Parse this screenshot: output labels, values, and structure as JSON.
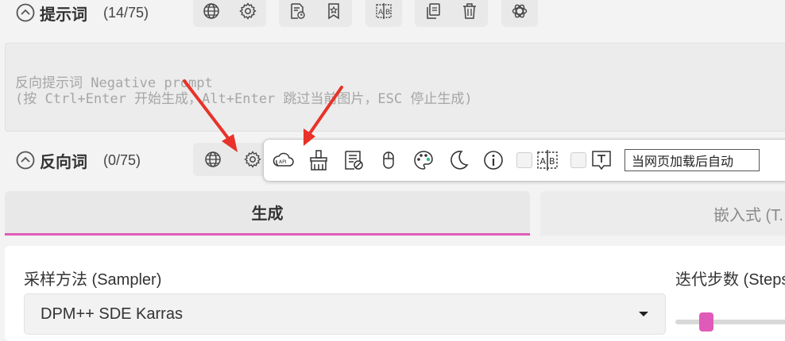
{
  "prompt_row": {
    "label": "提示词",
    "count": "(14/75)"
  },
  "negative_textarea": {
    "placeholder": "反向提示词 Negative prompt\n(按 Ctrl+Enter 开始生成，Alt+Enter 跳过当前图片，ESC 停止生成)"
  },
  "negative_row": {
    "label": "反向词",
    "count": "(0/75)"
  },
  "toolbar": {
    "input_value": "当网页加载后自动",
    "icons": [
      "cloud-api-icon",
      "brush-icon",
      "clear-text-icon",
      "mouse-icon",
      "palette-icon",
      "moon-icon",
      "info-icon",
      "ab-split-icon",
      "text-box-icon"
    ]
  },
  "tabs": {
    "generate": "生成",
    "embed": "嵌入式 (T."
  },
  "sampler": {
    "label": "采样方法 (Sampler)",
    "value": "DPM++ SDE Karras"
  },
  "steps": {
    "label": "迭代步数 (Steps)"
  },
  "colors": {
    "accent": "#e05bb8",
    "arrow": "#e8322a"
  }
}
